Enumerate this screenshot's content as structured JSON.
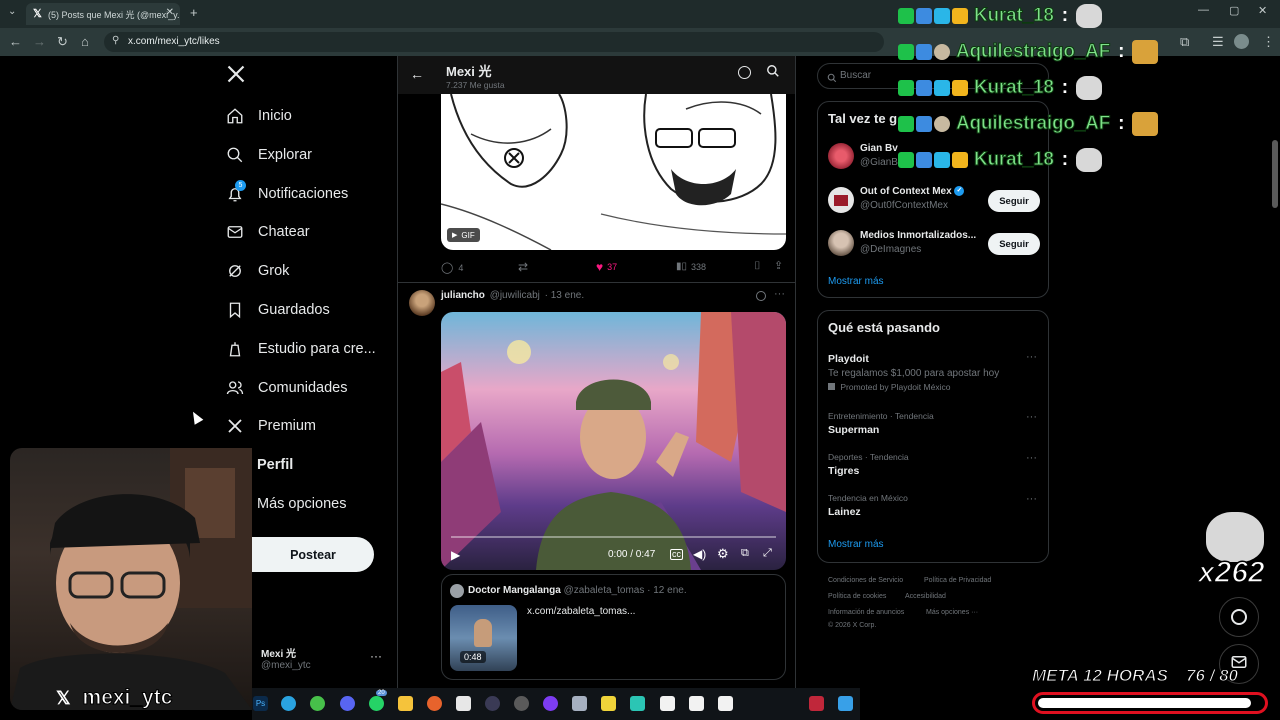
{
  "browser": {
    "tab_title": "(5) Posts que Mexi 光 (@mexi_y...",
    "url": "x.com/mexi_ytc/likes"
  },
  "sidebar": {
    "items": [
      {
        "label": "Inicio",
        "icon": "home-icon"
      },
      {
        "label": "Explorar",
        "icon": "search-icon"
      },
      {
        "label": "Notificaciones",
        "icon": "bell-icon",
        "badge": "5"
      },
      {
        "label": "Chatear",
        "icon": "mail-icon"
      },
      {
        "label": "Grok",
        "icon": "grok-icon"
      },
      {
        "label": "Guardados",
        "icon": "bookmark-icon"
      },
      {
        "label": "Estudio para cre...",
        "icon": "studio-icon"
      },
      {
        "label": "Comunidades",
        "icon": "people-icon"
      },
      {
        "label": "Premium",
        "icon": "x-logo-icon"
      },
      {
        "label": "Perfil",
        "icon": "user-icon"
      },
      {
        "label": "Más opciones",
        "icon": "more-icon"
      }
    ],
    "post_label": "Postear",
    "account_name": "Mexi 光",
    "account_handle": "@mexi_ytc"
  },
  "header": {
    "title": "Mexi 光",
    "subtitle": "7.237 Me gusta"
  },
  "post1": {
    "gif_label": "GIF",
    "replies": "4",
    "likes": "37",
    "views": "338"
  },
  "post2": {
    "author": "juliancho",
    "handle": "@juwilicabj",
    "date": "· 13 ene.",
    "video_time": "0:00 / 0:47",
    "quote": {
      "author": "Doctor Mangalanga",
      "handle": "@zabaleta_tomas",
      "date": "· 12 ene.",
      "link": "x.com/zabaleta_tomas...",
      "duration": "0:48"
    }
  },
  "right": {
    "search_placeholder": "Buscar",
    "who_to_follow_title": "Tal vez te g...",
    "suggestions": [
      {
        "name": "Gian Bv",
        "handle": "@GianB"
      },
      {
        "name": "Out of Context Mex",
        "handle": "@Out0fContextMex",
        "button": "Seguir"
      },
      {
        "name": "Medios Inmortalizados...",
        "handle": "@DeImagnes",
        "button": "Seguir"
      }
    ],
    "show_more": "Mostrar más",
    "trends_title": "Qué está pasando",
    "trends": [
      {
        "title": "Playdoit",
        "desc": "Te regalamos $1,000 para apostar hoy",
        "promo": "Promoted by Playdoit México"
      },
      {
        "context": "Entretenimiento · Tendencia",
        "title": "Superman"
      },
      {
        "context": "Deportes · Tendencia",
        "title": "Tigres"
      },
      {
        "context": "Tendencia en México",
        "title": "Lainez"
      }
    ],
    "trends_more": "Mostrar más",
    "footer": [
      "Condiciones de Servicio",
      "Política de Privacidad",
      "Política de cookies",
      "Accesibilidad",
      "Información de anuncios",
      "Más opciones ···",
      "© 2026 X Corp."
    ]
  },
  "overlay": {
    "chat": [
      {
        "name": "Kurat_18"
      },
      {
        "name": "Aquilestraigo_AF"
      },
      {
        "name": "Kurat_18"
      },
      {
        "name": "Aquilestraigo_AF"
      },
      {
        "name": "Kurat_18"
      }
    ],
    "streamer_name": "mexi_ytc",
    "combo": "x262",
    "goal_label": "META 12 HORAS",
    "goal_value": "76 / 80",
    "goal_progress": 0.95,
    "taskbar_badge": "20",
    "colors": {
      "chat_name": "#7fe28a",
      "accent_blue": "#1d9bf0",
      "like_pink": "#f91880",
      "goal_red": "#e01020"
    }
  }
}
